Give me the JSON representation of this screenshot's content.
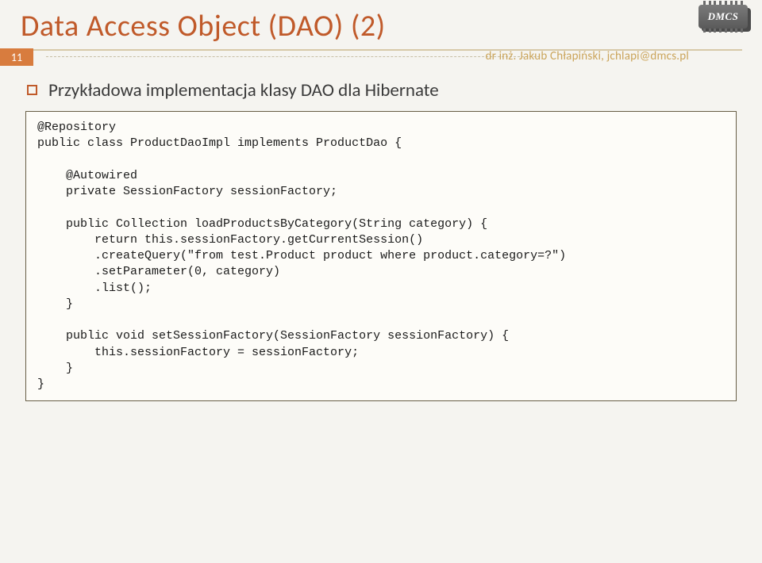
{
  "title": "Data Access Object (DAO) (2)",
  "page_number": "11",
  "footer_author": "dr inż. Jakub Chłapiński, jchlapi@dmcs.pl",
  "logo_label": "DMCS",
  "bullet1": "Przykładowa implementacja klasy DAO dla Hibernate",
  "code": "@Repository\npublic class ProductDaoImpl implements ProductDao {\n\n    @Autowired\n    private SessionFactory sessionFactory;\n\n    public Collection loadProductsByCategory(String category) {\n        return this.sessionFactory.getCurrentSession()\n        .createQuery(\"from test.Product product where product.category=?\")\n        .setParameter(0, category)\n        .list();\n    }\n\n    public void setSessionFactory(SessionFactory sessionFactory) {\n        this.sessionFactory = sessionFactory;\n    }\n}"
}
